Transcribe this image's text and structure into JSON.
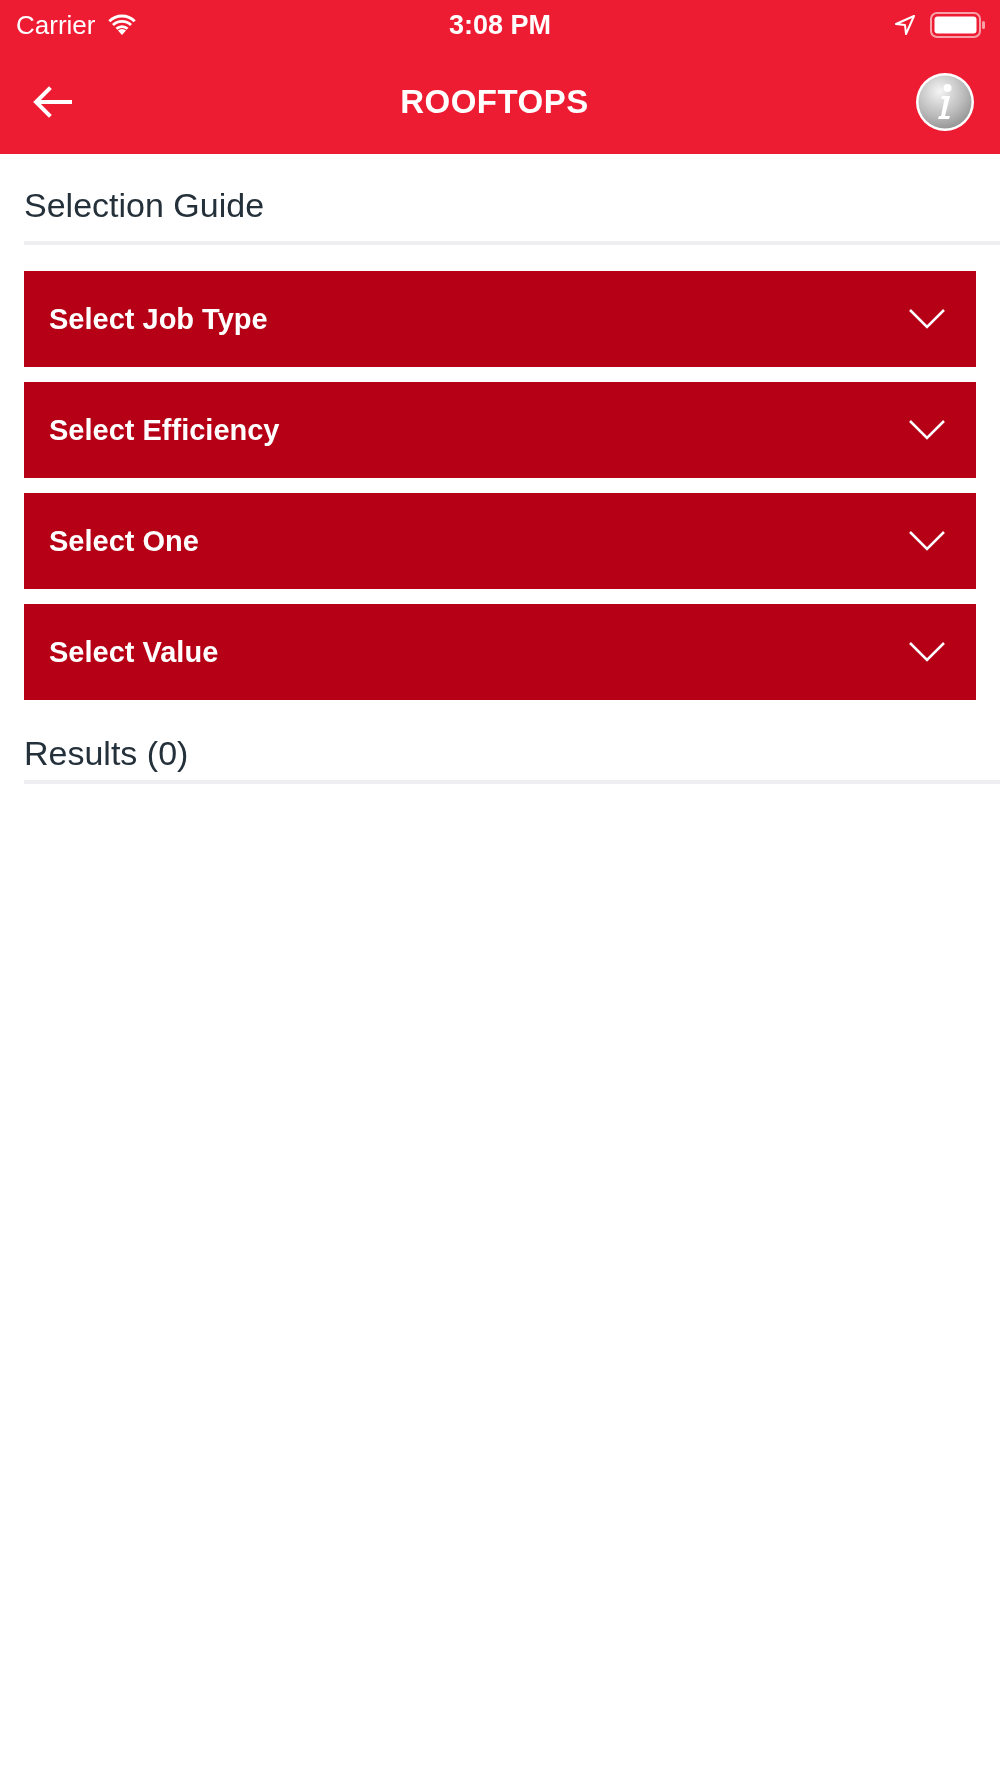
{
  "status_bar": {
    "carrier": "Carrier",
    "time": "3:08 PM"
  },
  "header": {
    "title": "ROOFTOPS"
  },
  "selection_guide": {
    "title": "Selection Guide",
    "dropdowns": [
      {
        "label": "Select Job Type",
        "expanded": false
      },
      {
        "label": "Select Efficiency",
        "expanded": false
      },
      {
        "label": "Select One",
        "expanded": false
      },
      {
        "label": "Select Value",
        "expanded": false
      }
    ]
  },
  "results": {
    "title": "Results (0)"
  }
}
